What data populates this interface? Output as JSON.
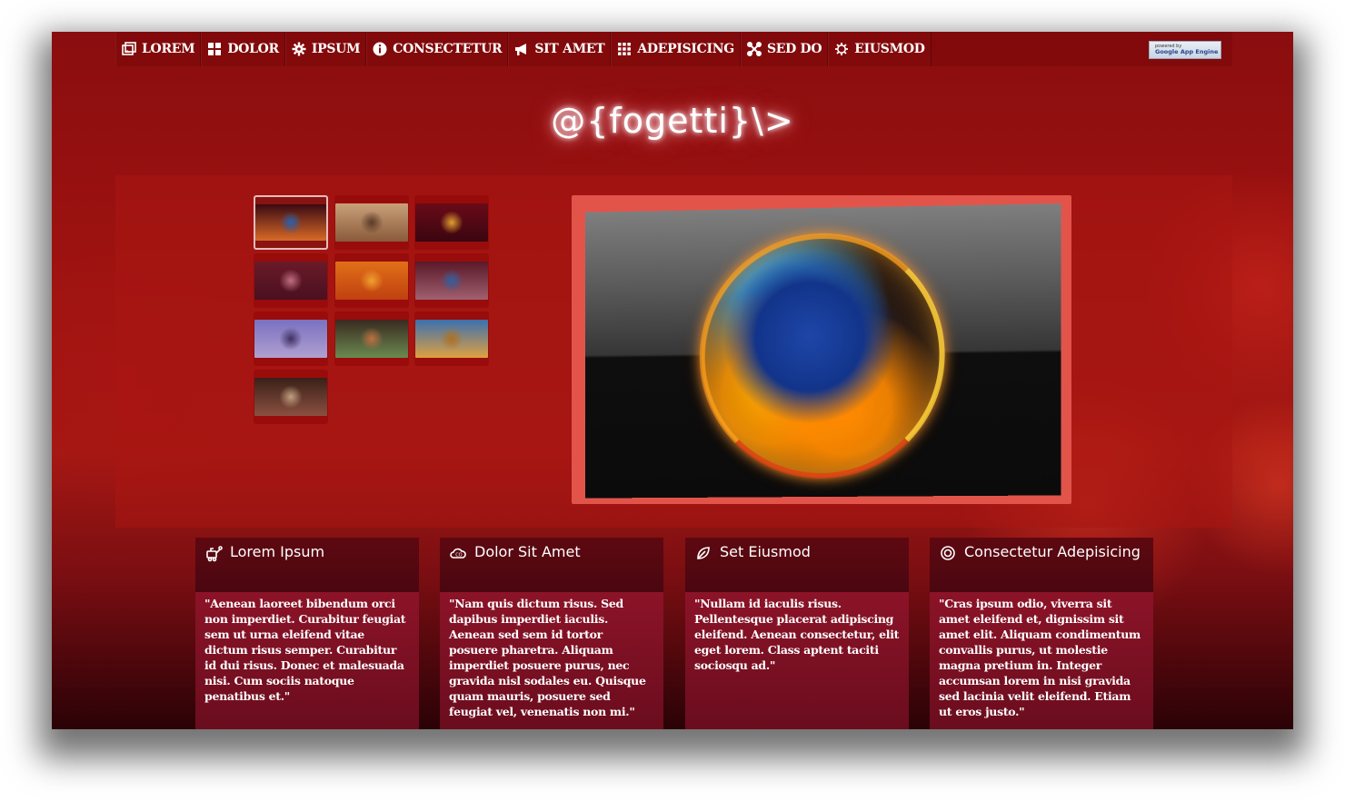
{
  "nav": {
    "items": [
      {
        "label": "LOREM",
        "icon": "picture-icon"
      },
      {
        "label": "DOLOR",
        "icon": "grid-icon"
      },
      {
        "label": "IPSUM",
        "icon": "gear-icon"
      },
      {
        "label": "CONSECTETUR",
        "icon": "info-icon"
      },
      {
        "label": "SIT AMET",
        "icon": "megaphone-icon"
      },
      {
        "label": "ADEPISICING",
        "icon": "apps-icon"
      },
      {
        "label": "SED DO",
        "icon": "butterfly-icon"
      },
      {
        "label": "EIUSMOD",
        "icon": "gear-outline-icon"
      }
    ],
    "badge": {
      "small": "powered by",
      "big": "Google App Engine"
    }
  },
  "logo": "@{fogetti}\\>",
  "gallery": {
    "thumbnails": [
      {
        "name": "firefox",
        "colors": [
          "#3a0a12",
          "#d86a28",
          "#2860b0"
        ]
      },
      {
        "name": "tree-dusk",
        "colors": [
          "#c9a07a",
          "#8a5a3a",
          "#5a3a28"
        ]
      },
      {
        "name": "apple-red",
        "colors": [
          "#6a0a18",
          "#3a0610",
          "#e0a030"
        ]
      },
      {
        "name": "apple-leaf",
        "colors": [
          "#6a1a28",
          "#4a1020",
          "#c07080"
        ]
      },
      {
        "name": "firefox-orange",
        "colors": [
          "#e07018",
          "#c04010",
          "#f0a030"
        ]
      },
      {
        "name": "chrome-bubbles",
        "colors": [
          "#5a1828",
          "#a06070",
          "#3060a0"
        ]
      },
      {
        "name": "lake-purple",
        "colors": [
          "#7a70c0",
          "#b0a0d0",
          "#403060"
        ]
      },
      {
        "name": "earth-bubble",
        "colors": [
          "#3a2a20",
          "#6a8a50",
          "#c07040"
        ]
      },
      {
        "name": "wheat-field",
        "colors": [
          "#3a70b0",
          "#e0a040",
          "#b07020"
        ]
      },
      {
        "name": "forest-trees",
        "colors": [
          "#3a2018",
          "#8a5040",
          "#c0a080"
        ]
      }
    ],
    "active_index": 0
  },
  "cards": [
    {
      "title": "Lorem Ipsum",
      "icon": "robot-icon",
      "text": "\"Aenean laoreet bibendum orci non imperdiet. Curabitur feugiat sem ut urna eleifend vitae dictum risus semper. Curabitur id dui risus. Donec et malesuada nisi. Cum sociis natoque penatibus et.\""
    },
    {
      "title": "Dolor Sit Amet",
      "icon": "cloud-icon",
      "text": "\"Nam quis dictum risus. Sed dapibus imperdiet iaculis. Aenean sed sem id tortor posuere pharetra. Aliquam imperdiet posuere purus, nec gravida nisl sodales eu. Quisque quam mauris, posuere sed feugiat vel, venenatis non mi.\""
    },
    {
      "title": "Set Eiusmod",
      "icon": "leaf-icon",
      "text": "\"Nullam id iaculis risus. Pellentesque placerat adipiscing eleifend. Aenean consectetur, elit eget lorem. Class aptent taciti sociosqu ad.\""
    },
    {
      "title": "Consectetur Adepisicing",
      "icon": "target-icon",
      "text": "\"Cras ipsum odio, viverra sit amet eleifend et, dignissim sit amet elit. Aliquam condimentum convallis purus, ut molestie magna pretium in. Integer accumsan lorem in nisi gravida sed lacinia velit eleifend. Etiam ut eros justo.\""
    }
  ]
}
